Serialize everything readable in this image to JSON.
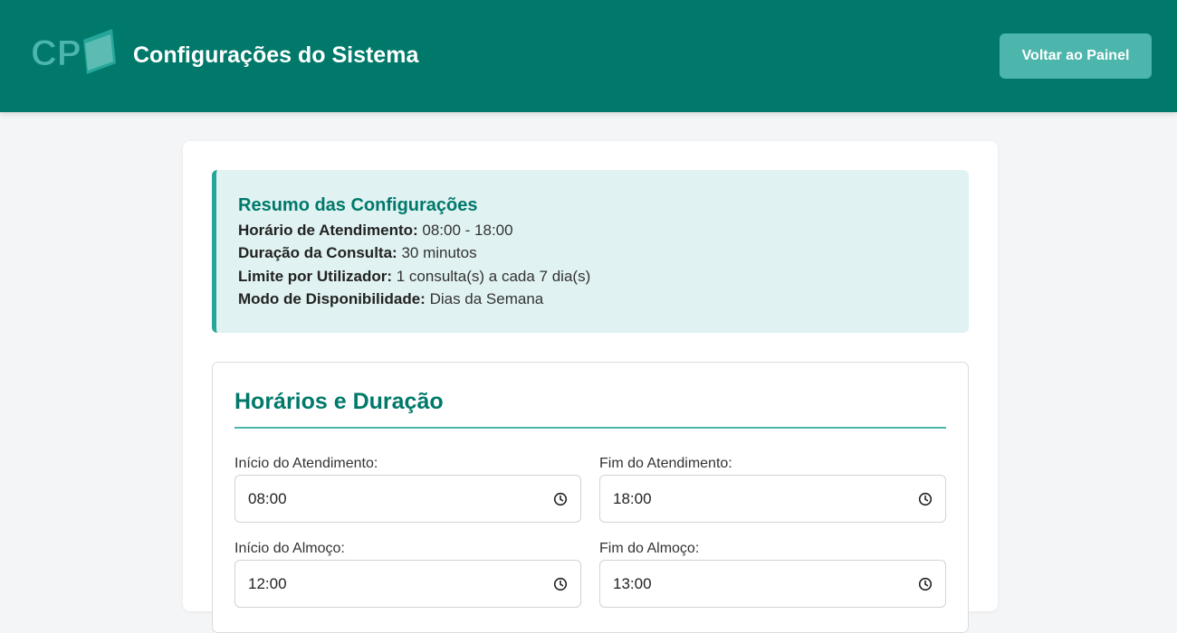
{
  "header": {
    "logo_text": "CP",
    "title": "Configurações do Sistema",
    "back_button": "Voltar ao Painel"
  },
  "summary": {
    "title": "Resumo das Configurações",
    "rows": [
      {
        "label": "Horário de Atendimento:",
        "value": "08:00 - 18:00"
      },
      {
        "label": "Duração da Consulta:",
        "value": "30 minutos"
      },
      {
        "label": "Limite por Utilizador:",
        "value": "1 consulta(s) a cada 7 dia(s)"
      },
      {
        "label": "Modo de Disponibilidade:",
        "value": "Dias da Semana"
      }
    ]
  },
  "schedule": {
    "title": "Horários e Duração",
    "fields": [
      {
        "label": "Início do Atendimento:",
        "value": "08:00",
        "icon": "clock-icon"
      },
      {
        "label": "Fim do Atendimento:",
        "value": "18:00",
        "icon": "clock-icon"
      },
      {
        "label": "Início do Almoço:",
        "value": "12:00",
        "icon": "clock-icon"
      },
      {
        "label": "Fim do Almoço:",
        "value": "13:00",
        "icon": "clock-icon"
      }
    ]
  },
  "colors": {
    "primary": "#00796b",
    "accent": "#4db6ac",
    "summary_bg": "#e0f2f1",
    "page_bg": "#f4f5f7"
  }
}
